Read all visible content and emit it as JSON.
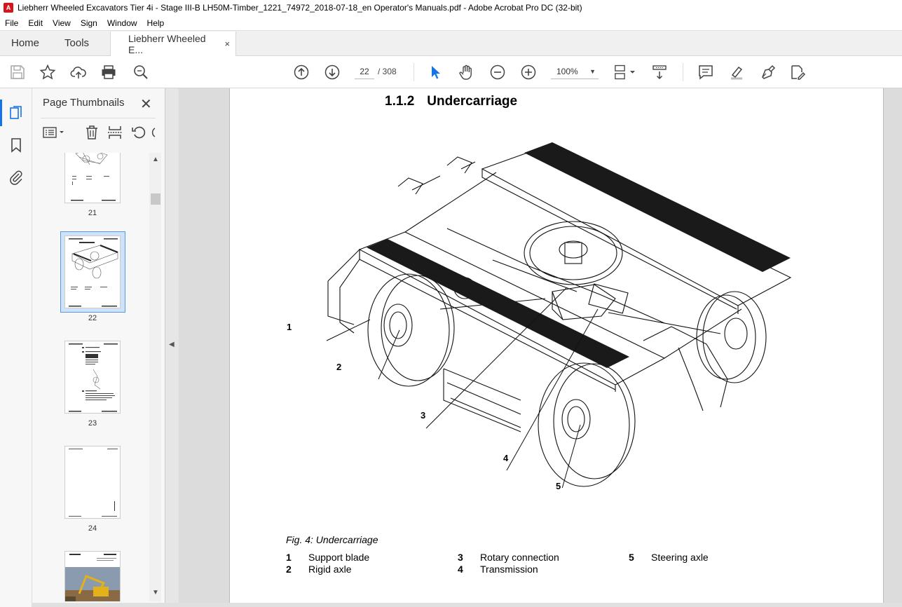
{
  "window": {
    "title": "Liebherr Wheeled Excavators Tier 4i - Stage III-B LH50M-Timber_1221_74972_2018-07-18_en Operator's Manuals.pdf - Adobe Acrobat Pro DC (32-bit)"
  },
  "menu": [
    "File",
    "Edit",
    "View",
    "Sign",
    "Window",
    "Help"
  ],
  "tabs": {
    "home": "Home",
    "tools": "Tools",
    "doc": "Liebherr Wheeled E...",
    "close": "×"
  },
  "toolbar": {
    "page_current": "22",
    "page_total": "/ 308",
    "zoom": "100%"
  },
  "panel": {
    "title": "Page Thumbnails",
    "close": "✕",
    "thumbnails": [
      {
        "label": "21"
      },
      {
        "label": "22",
        "selected": true
      },
      {
        "label": "23"
      },
      {
        "label": "24"
      },
      {
        "label": ""
      }
    ]
  },
  "document": {
    "section_number": "1.1.2",
    "section_title": "Undercarriage",
    "figure_caption": "Fig. 4: Undercarriage",
    "callouts": [
      "1",
      "2",
      "3",
      "4",
      "5"
    ],
    "legend": [
      {
        "num": "1",
        "text": "Support blade"
      },
      {
        "num": "2",
        "text": "Rigid axle"
      },
      {
        "num": "3",
        "text": "Rotary connection"
      },
      {
        "num": "4",
        "text": "Transmission"
      },
      {
        "num": "5",
        "text": "Steering axle"
      }
    ]
  },
  "colors": {
    "accent": "#1473e6",
    "acrobat_red": "#d4161c"
  }
}
